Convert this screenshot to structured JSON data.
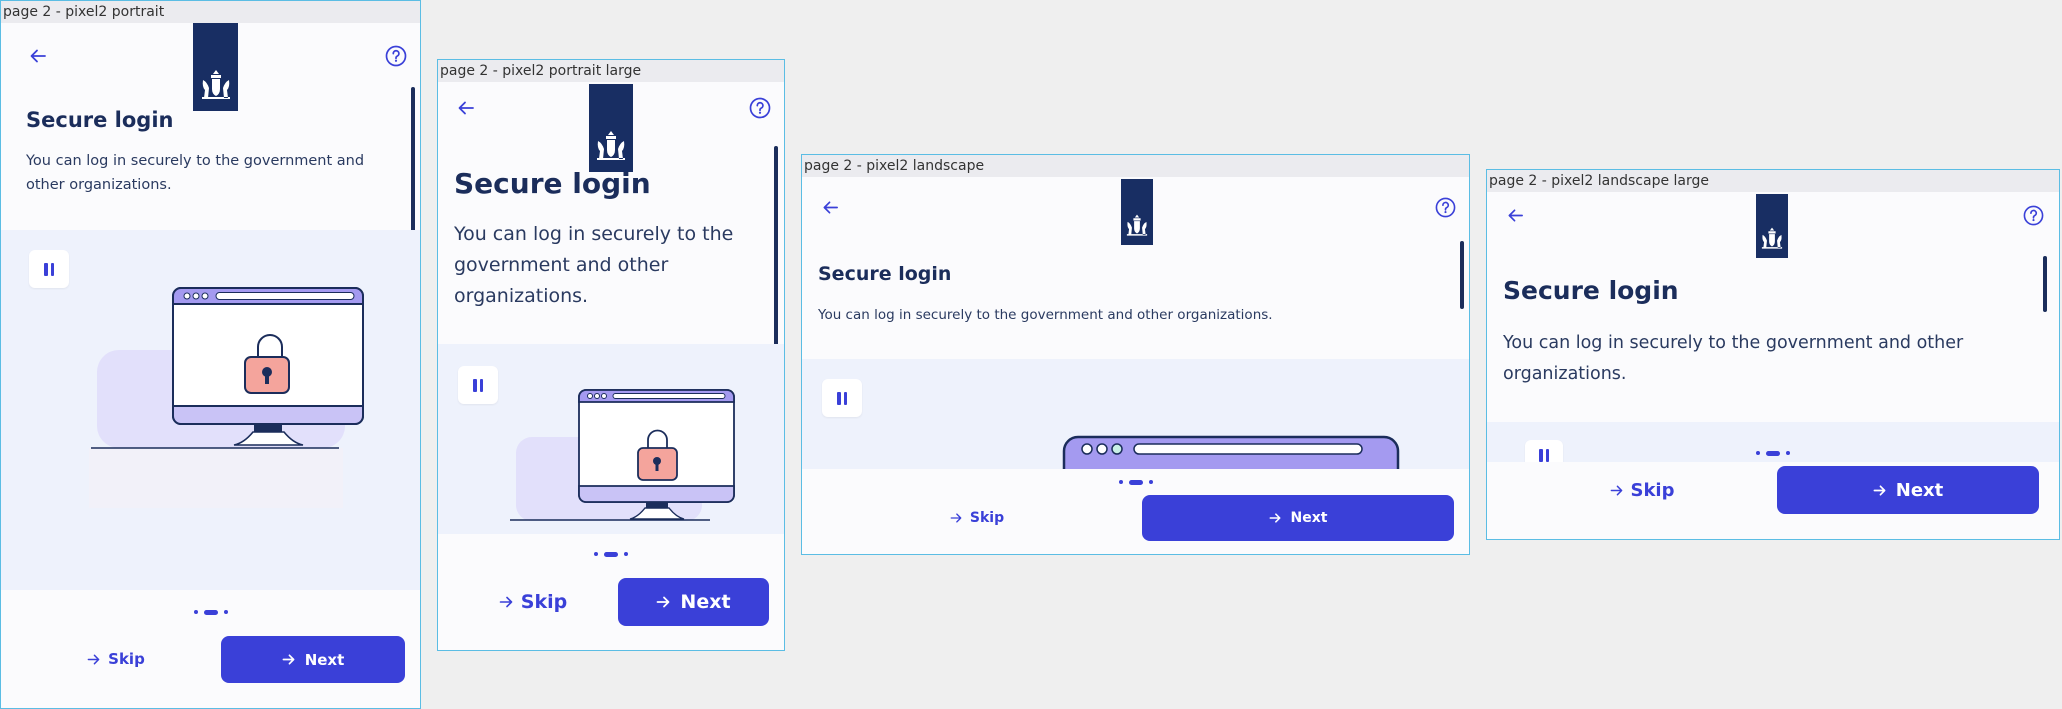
{
  "colors": {
    "brand_blue": "#3a40d8",
    "navy": "#182e63",
    "title": "#1b2d5b",
    "illustration_bg": "#eef2fc",
    "frame_border": "#5bbde4"
  },
  "screen": {
    "title": "Secure login",
    "body": "You can log in securely to the government and other organizations.",
    "skip_label": "Skip",
    "next_label": "Next",
    "back_icon": "arrow-left-icon",
    "help_icon": "question-circle-icon",
    "pause_icon": "pause-icon",
    "page_indicator": {
      "total": 3,
      "active": 2
    }
  },
  "frames": [
    {
      "label": "page  2 - pixel2  portrait"
    },
    {
      "label": "page  2 - pixel2  portrait  large"
    },
    {
      "label": "page  2 - pixel2  landscape"
    },
    {
      "label": "page  2 - pixel2  landscape  large"
    }
  ]
}
